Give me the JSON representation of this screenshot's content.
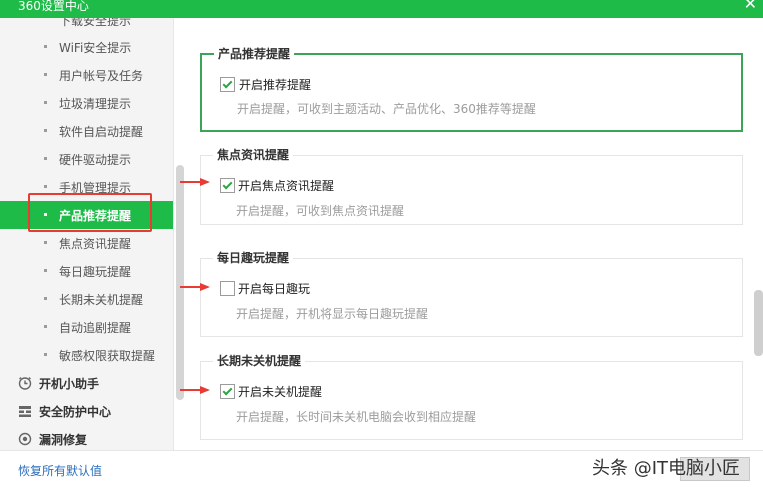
{
  "window": {
    "title": "360设置中心",
    "close_glyph": "✕"
  },
  "sidebar": {
    "items": [
      {
        "label": "下载安全提示",
        "active": false
      },
      {
        "label": "WiFi安全提示",
        "active": false
      },
      {
        "label": "用户帐号及任务",
        "active": false
      },
      {
        "label": "垃圾清理提示",
        "active": false
      },
      {
        "label": "软件自启动提醒",
        "active": false
      },
      {
        "label": "硬件驱动提示",
        "active": false
      },
      {
        "label": "手机管理提示",
        "active": false
      },
      {
        "label": "产品推荐提醒",
        "active": true
      },
      {
        "label": "焦点资讯提醒",
        "active": false
      },
      {
        "label": "每日趣玩提醒",
        "active": false
      },
      {
        "label": "长期未关机提醒",
        "active": false
      },
      {
        "label": "自动追剧提醒",
        "active": false
      },
      {
        "label": "敏感权限获取提醒",
        "active": false
      }
    ],
    "sections": [
      {
        "label": "开机小助手",
        "icon": "clock-icon"
      },
      {
        "label": "安全防护中心",
        "icon": "grid-icon"
      },
      {
        "label": "漏洞修复",
        "icon": "shield-icon"
      }
    ]
  },
  "groups": [
    {
      "title": "产品推荐提醒",
      "option": "开启推荐提醒",
      "checked": true,
      "desc": "开启提醒，可收到主题活动、产品优化、360推荐等提醒"
    },
    {
      "title": "焦点资讯提醒",
      "option": "开启焦点资讯提醒",
      "checked": true,
      "desc": "开启提醒，可收到焦点资讯提醒"
    },
    {
      "title": "每日趣玩提醒",
      "option": "开启每日趣玩",
      "checked": false,
      "desc": "开启提醒，开机将显示每日趣玩提醒"
    },
    {
      "title": "长期未关机提醒",
      "option": "开启未关机提醒",
      "checked": true,
      "desc": "开启提醒，长时间未关机电脑会收到相应提醒"
    }
  ],
  "footer": {
    "reset_label": "恢复所有默认值",
    "watermark": "头条 @IT电脑小匠"
  },
  "colors": {
    "accent": "#1fbb49",
    "highlight": "#e73b34",
    "link": "#2a6ebb"
  }
}
